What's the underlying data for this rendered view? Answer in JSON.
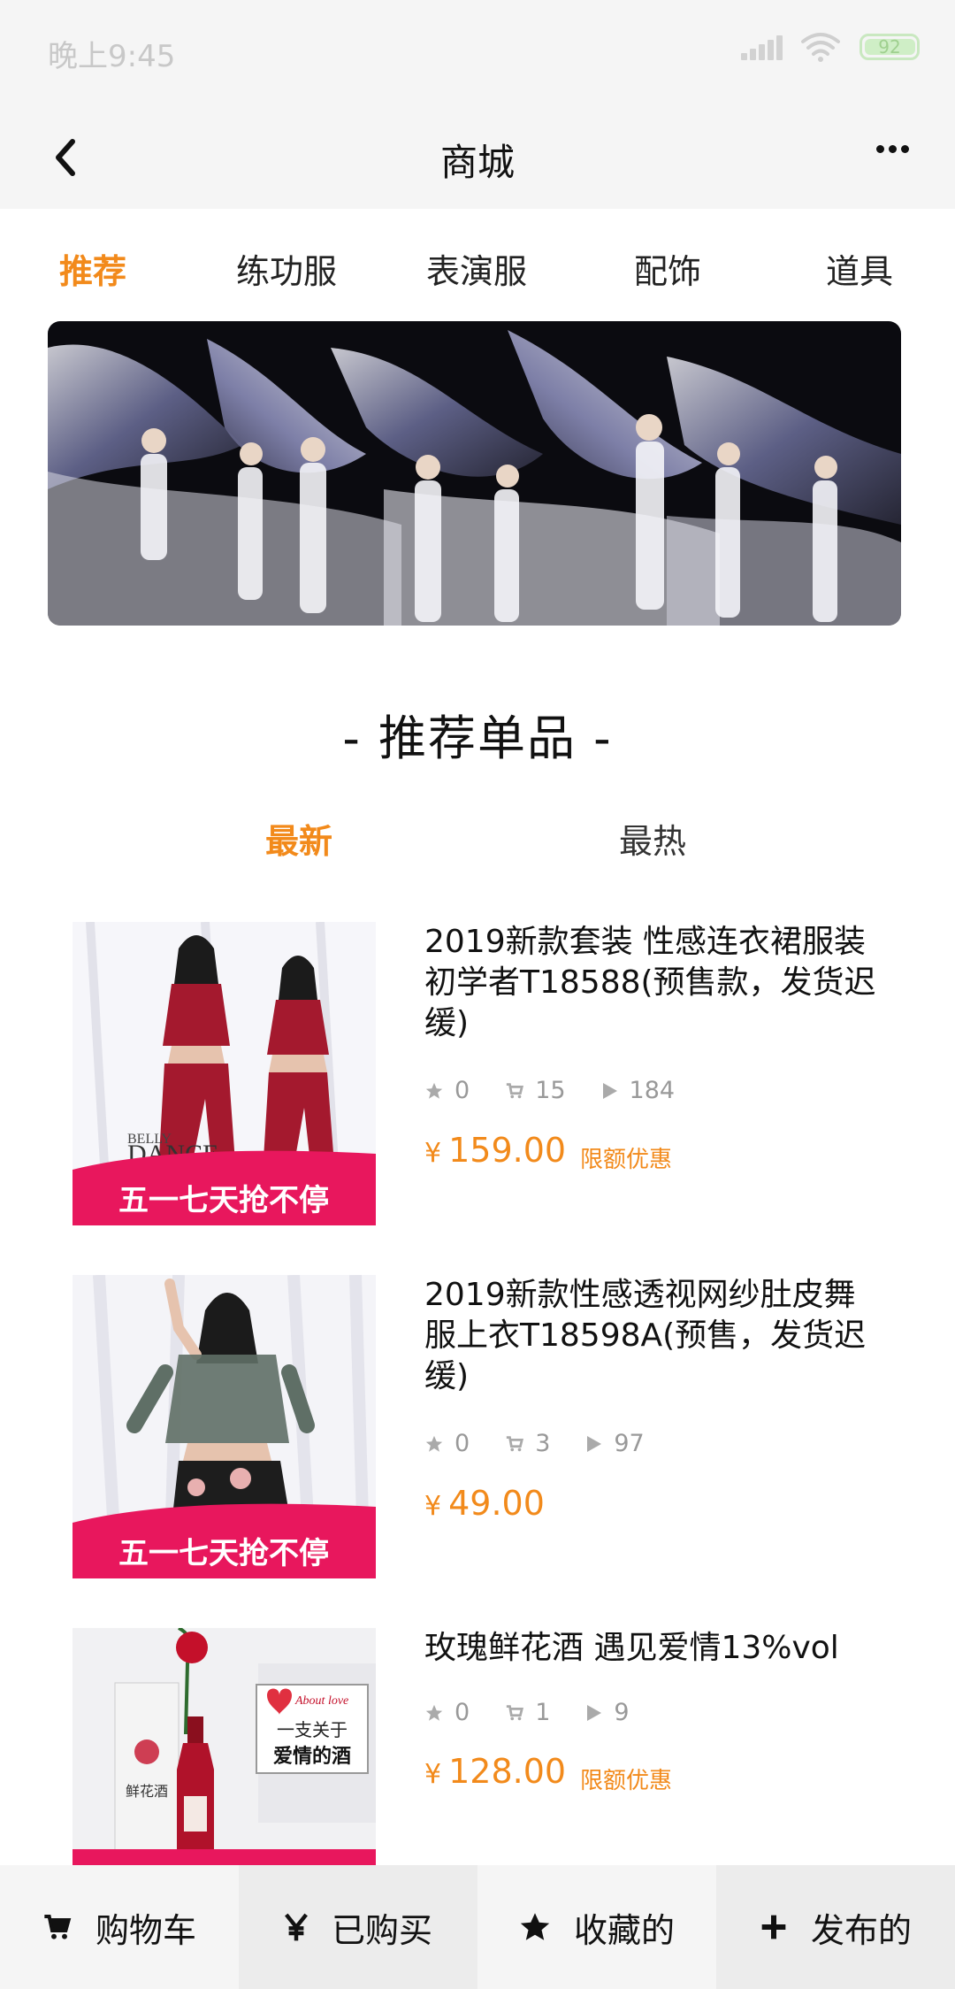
{
  "status_bar": {
    "time": "晚上9:45",
    "battery": "92"
  },
  "nav": {
    "title": "商城"
  },
  "category_tabs": [
    {
      "label": "推荐",
      "active": true
    },
    {
      "label": "练功服",
      "active": false
    },
    {
      "label": "表演服",
      "active": false
    },
    {
      "label": "配饰",
      "active": false
    },
    {
      "label": "道具",
      "active": false
    }
  ],
  "section": {
    "title": "- 推荐单品 -"
  },
  "sort_tabs": [
    {
      "label": "最新",
      "active": true
    },
    {
      "label": "最热",
      "active": false
    }
  ],
  "products": [
    {
      "title": "2019新款套装 性感连衣裙服装初学者T18588(预售款，发货迟缓)",
      "stars": "0",
      "cart": "15",
      "views": "184",
      "currency": "¥",
      "price": "159.00",
      "promo": "限额优惠",
      "image_banner_text": "五一七天抢不停",
      "image_brand_small": "BELLY",
      "image_brand": "DANCE"
    },
    {
      "title": "2019新款性感透视网纱肚皮舞服上衣T18598A(预售，发货迟缓)",
      "stars": "0",
      "cart": "3",
      "views": "97",
      "currency": "¥",
      "price": "49.00",
      "promo": "",
      "image_banner_text": "五一七天抢不停"
    },
    {
      "title": "玫瑰鲜花酒 遇见爱情13%vol",
      "stars": "0",
      "cart": "1",
      "views": "9",
      "currency": "¥",
      "price": "128.00",
      "promo": "限额优惠",
      "image_tag_script": "About love",
      "image_tag_line1": "一支关于",
      "image_tag_line2": "爱情的酒",
      "image_bottle_text": "鲜花酒"
    }
  ],
  "bottom_bar": [
    {
      "label": "购物车",
      "icon": "cart-icon"
    },
    {
      "label": "已购买",
      "icon": "yen-icon"
    },
    {
      "label": "收藏的",
      "icon": "star-icon"
    },
    {
      "label": "发布的",
      "icon": "plus-icon"
    }
  ],
  "colors": {
    "accent": "#f28a1b",
    "bar_bg": "#f5f5f5",
    "bar_alt": "#ececec",
    "promo_pink": "#e8175d"
  }
}
